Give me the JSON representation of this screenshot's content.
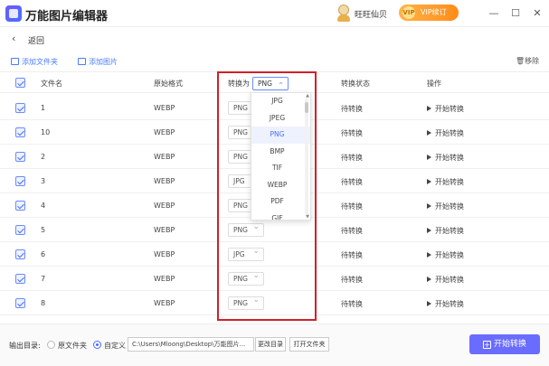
{
  "app": {
    "title": "万能图片编辑器",
    "username": "旺旺仙贝",
    "vip_label": "VIP续订",
    "vip_badge": "VIP"
  },
  "window": {
    "minimize": "—",
    "maximize": "☐",
    "close": "✕"
  },
  "nav": {
    "back_label": "返回"
  },
  "toolbar": {
    "add_folder": "添加文件夹",
    "add_image": "添加图片",
    "remove": "移除"
  },
  "table": {
    "headers": {
      "name": "文件名",
      "orig_format": "原始格式",
      "convert_to": "转换为",
      "status": "转换状态",
      "action": "操作"
    },
    "header_select_value": "PNG",
    "rows": [
      {
        "name": "1",
        "orig": "WEBP",
        "target": "PNG",
        "status": "待转换",
        "action": "开始转换"
      },
      {
        "name": "10",
        "orig": "WEBP",
        "target": "PNG",
        "status": "待转换",
        "action": "开始转换"
      },
      {
        "name": "2",
        "orig": "WEBP",
        "target": "PNG",
        "status": "待转换",
        "action": "开始转换"
      },
      {
        "name": "3",
        "orig": "WEBP",
        "target": "JPG",
        "status": "待转换",
        "action": "开始转换"
      },
      {
        "name": "4",
        "orig": "WEBP",
        "target": "PNG",
        "status": "待转换",
        "action": "开始转换"
      },
      {
        "name": "5",
        "orig": "WEBP",
        "target": "PNG",
        "status": "待转换",
        "action": "开始转换"
      },
      {
        "name": "6",
        "orig": "WEBP",
        "target": "JPG",
        "status": "待转换",
        "action": "开始转换"
      },
      {
        "name": "7",
        "orig": "WEBP",
        "target": "PNG",
        "status": "待转换",
        "action": "开始转换"
      },
      {
        "name": "8",
        "orig": "WEBP",
        "target": "PNG",
        "status": "待转换",
        "action": "开始转换"
      }
    ]
  },
  "dropdown": {
    "options": [
      "JPG",
      "JPEG",
      "PNG",
      "BMP",
      "TIF",
      "WEBP",
      "PDF",
      "GIF"
    ],
    "selected": "PNG"
  },
  "footer": {
    "output_label": "输出目录:",
    "opt_source": "原文件夹",
    "opt_custom": "自定义",
    "path": "C:\\Users\\Mloong\\Desktop\\万能图片...",
    "change_dir": "更改目录",
    "open_folder": "打开文件夹",
    "start_all": "开始转换"
  },
  "colors": {
    "accent": "#4a6cff",
    "highlight": "#d0202a",
    "vip": "#ff8c1a"
  }
}
